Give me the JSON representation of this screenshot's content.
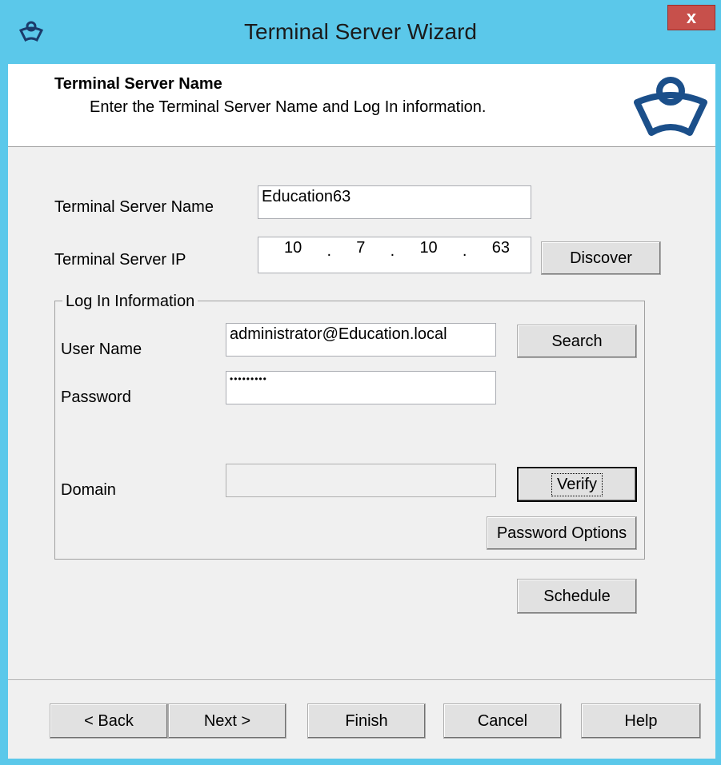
{
  "window": {
    "title": "Terminal Server Wizard",
    "close_label": "x",
    "accent_color": "#5bc8ea"
  },
  "header": {
    "title": "Terminal Server Name",
    "subtitle": "Enter the Terminal Server Name and Log In information.",
    "logo_icon": "thinmanager-logo-icon"
  },
  "form": {
    "server_name_label": "Terminal Server Name",
    "server_name_value": "Education63",
    "server_ip_label": "Terminal Server IP",
    "ip_octets": [
      "10",
      "7",
      "10",
      "63"
    ],
    "discover_label": "Discover"
  },
  "login": {
    "group_label": "Log In Information",
    "user_label": "User Name",
    "user_value": "administrator@Education.local",
    "search_label": "Search",
    "password_label": "Password",
    "password_value": "•••••••••",
    "domain_label": "Domain",
    "domain_value": "",
    "verify_label": "Verify",
    "password_options_label": "Password Options"
  },
  "schedule_label": "Schedule",
  "footer": {
    "back_label": "< Back",
    "next_label": "Next >",
    "finish_label": "Finish",
    "cancel_label": "Cancel",
    "help_label": "Help"
  }
}
